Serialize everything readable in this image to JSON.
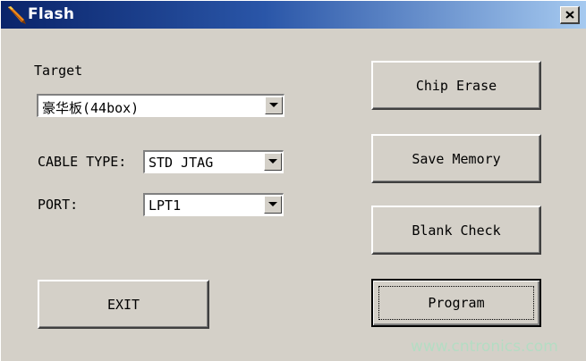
{
  "window": {
    "title": "Flash"
  },
  "target": {
    "label": "Target",
    "value": "豪华板(44box)"
  },
  "cable_type": {
    "label": "CABLE TYPE:",
    "value": "STD JTAG"
  },
  "port": {
    "label": "PORT:",
    "value": "LPT1"
  },
  "buttons": {
    "chip_erase": "Chip Erase",
    "save_memory": "Save Memory",
    "blank_check": "Blank Check",
    "program": "Program",
    "exit": "EXIT"
  },
  "watermark": "www.cntronics.com",
  "colors": {
    "face": "#d4d0c8",
    "title_start": "#0a246a",
    "title_end": "#a6caf0",
    "watermark": "#b4dcc3"
  }
}
